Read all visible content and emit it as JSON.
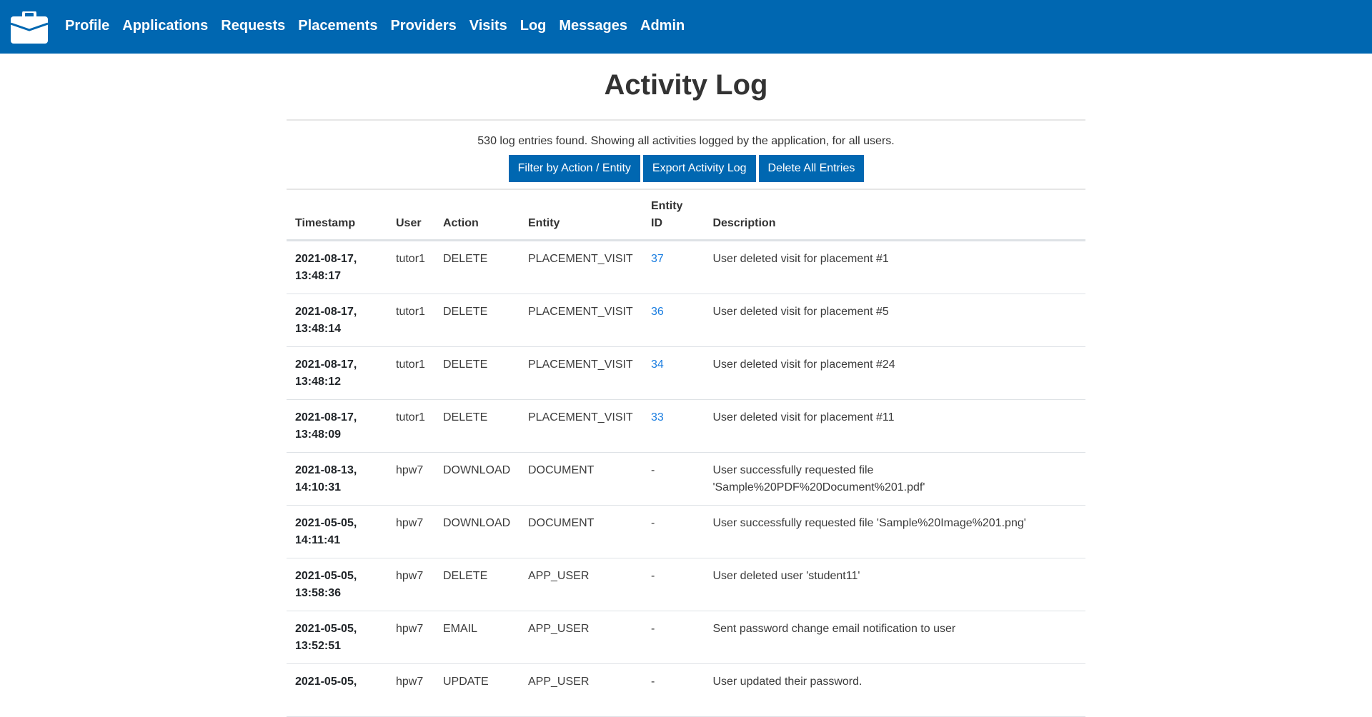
{
  "navbar": {
    "brand_icon": "briefcase-icon",
    "items": [
      {
        "label": "Profile"
      },
      {
        "label": "Applications"
      },
      {
        "label": "Requests"
      },
      {
        "label": "Placements"
      },
      {
        "label": "Providers"
      },
      {
        "label": "Visits"
      },
      {
        "label": "Log"
      },
      {
        "label": "Messages"
      },
      {
        "label": "Admin"
      }
    ]
  },
  "page": {
    "title": "Activity Log",
    "summary": "530 log entries found. Showing all activities logged by the application, for all users.",
    "buttons": {
      "filter": "Filter by Action / Entity",
      "export": "Export Activity Log",
      "delete_all": "Delete All Entries"
    }
  },
  "table": {
    "headers": {
      "timestamp": "Timestamp",
      "user": "User",
      "action": "Action",
      "entity": "Entity",
      "entity_id": "Entity ID",
      "description": "Description"
    },
    "rows": [
      {
        "date": "2021-08-17,",
        "time": "13:48:17",
        "user": "tutor1",
        "action": "DELETE",
        "entity": "PLACEMENT_VISIT",
        "entity_id": "37",
        "description": "User deleted visit for placement #1"
      },
      {
        "date": "2021-08-17,",
        "time": "13:48:14",
        "user": "tutor1",
        "action": "DELETE",
        "entity": "PLACEMENT_VISIT",
        "entity_id": "36",
        "description": "User deleted visit for placement #5"
      },
      {
        "date": "2021-08-17,",
        "time": "13:48:12",
        "user": "tutor1",
        "action": "DELETE",
        "entity": "PLACEMENT_VISIT",
        "entity_id": "34",
        "description": "User deleted visit for placement #24"
      },
      {
        "date": "2021-08-17,",
        "time": "13:48:09",
        "user": "tutor1",
        "action": "DELETE",
        "entity": "PLACEMENT_VISIT",
        "entity_id": "33",
        "description": "User deleted visit for placement #11"
      },
      {
        "date": "2021-08-13,",
        "time": "14:10:31",
        "user": "hpw7",
        "action": "DOWNLOAD",
        "entity": "DOCUMENT",
        "entity_id": "-",
        "description": "User successfully requested file 'Sample%20PDF%20Document%201.pdf'"
      },
      {
        "date": "2021-05-05,",
        "time": "14:11:41",
        "user": "hpw7",
        "action": "DOWNLOAD",
        "entity": "DOCUMENT",
        "entity_id": "-",
        "description": "User successfully requested file 'Sample%20Image%201.png'"
      },
      {
        "date": "2021-05-05,",
        "time": "13:58:36",
        "user": "hpw7",
        "action": "DELETE",
        "entity": "APP_USER",
        "entity_id": "-",
        "description": "User deleted user 'student11'"
      },
      {
        "date": "2021-05-05,",
        "time": "13:52:51",
        "user": "hpw7",
        "action": "EMAIL",
        "entity": "APP_USER",
        "entity_id": "-",
        "description": "Sent password change email notification to user"
      },
      {
        "date": "2021-05-05,",
        "time": "",
        "user": "hpw7",
        "action": "UPDATE",
        "entity": "APP_USER",
        "entity_id": "-",
        "description": "User updated their password."
      }
    ]
  },
  "colors": {
    "brand": "#0067b1",
    "link": "#1a7de0",
    "text": "#333333"
  }
}
